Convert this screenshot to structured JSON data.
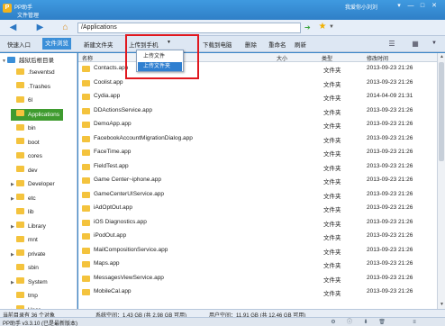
{
  "window": {
    "app_name": "PP助手",
    "subtitle": "文件管理",
    "user": "我爱你小刘刘",
    "controls": [
      "▾",
      "—",
      "□",
      "✕"
    ]
  },
  "address": {
    "path": "/Applications",
    "back_icon": "arrow-left-icon",
    "forward_icon": "arrow-right-icon",
    "home_icon": "home-icon"
  },
  "toolbar": {
    "tab_nav": "快速入口",
    "tab_files": "文件浏览",
    "new_folder": "新建文件夹",
    "upload": "上传到手机",
    "download": "下载到电脑",
    "delete": "删除",
    "rename": "重命名",
    "refresh": "刷新"
  },
  "upload_menu": {
    "items": [
      "上传文件",
      "上传文件夹"
    ],
    "highlighted_index": 1
  },
  "sidebar": {
    "root": "越狱后根目录",
    "items": [
      ".fseventsd",
      ".Trashes",
      "6l",
      "Applications",
      "bin",
      "boot",
      "cores",
      "dev",
      "Developer",
      "etc",
      "lib",
      "Library",
      "mnt",
      "private",
      "sbin",
      "System",
      "tmp",
      "User"
    ],
    "expandable": [
      false,
      false,
      false,
      false,
      false,
      false,
      false,
      false,
      true,
      true,
      false,
      true,
      false,
      true,
      false,
      true,
      false,
      true
    ],
    "selected_index": 3
  },
  "list": {
    "columns": {
      "name": "名称",
      "size": "大小",
      "type": "类型",
      "date": "修改时间"
    },
    "rows": [
      {
        "name": "Contacts.app",
        "type": "文件夹",
        "date": "2013-09-23 21:26"
      },
      {
        "name": "Coolist.app",
        "type": "文件夹",
        "date": "2013-09-23 21:26"
      },
      {
        "name": "Cydia.app",
        "type": "文件夹",
        "date": "2014-04-09 21:31"
      },
      {
        "name": "DDActionsService.app",
        "type": "文件夹",
        "date": "2013-09-23 21:26"
      },
      {
        "name": "DemoApp.app",
        "type": "文件夹",
        "date": "2013-09-23 21:26"
      },
      {
        "name": "FacebookAccountMigrationDialog.app",
        "type": "文件夹",
        "date": "2013-09-23 21:26"
      },
      {
        "name": "FaceTime.app",
        "type": "文件夹",
        "date": "2013-09-23 21:26"
      },
      {
        "name": "FieldTest.app",
        "type": "文件夹",
        "date": "2013-09-23 21:26"
      },
      {
        "name": "Game Center~iphone.app",
        "type": "文件夹",
        "date": "2013-09-23 21:26"
      },
      {
        "name": "GameCenterUIService.app",
        "type": "文件夹",
        "date": "2013-09-23 21:26"
      },
      {
        "name": "iAdOptOut.app",
        "type": "文件夹",
        "date": "2013-09-23 21:26"
      },
      {
        "name": "iOS Diagnostics.app",
        "type": "文件夹",
        "date": "2013-09-23 21:26"
      },
      {
        "name": "iPodOut.app",
        "type": "文件夹",
        "date": "2013-09-23 21:26"
      },
      {
        "name": "MailCompositionService.app",
        "type": "文件夹",
        "date": "2013-09-23 21:26"
      },
      {
        "name": "Maps.app",
        "type": "文件夹",
        "date": "2013-09-23 21:26"
      },
      {
        "name": "MessagesViewService.app",
        "type": "文件夹",
        "date": "2013-09-23 21:26"
      },
      {
        "name": "MobileCal.app",
        "type": "文件夹",
        "date": "2013-09-23 21:26"
      }
    ]
  },
  "status": {
    "count": "当前目录有 36 个对象",
    "disk": "系统空间：1.43 GB (共 2.98 GB 可用)",
    "user": "用户空间：11.91 GB (共 12.46 GB 可用)"
  },
  "bottom": {
    "version": "PP助手 v3.3.10 (已是最新版本)",
    "icons": [
      "gear-icon",
      "info-icon",
      "download-icon",
      "trash-icon",
      "more-icon"
    ]
  },
  "colors": {
    "title_blue": "#2f7fc7",
    "selection_green": "#3f9b2f",
    "folder": "#f4c33d",
    "highlight_box": "#e0181f"
  }
}
